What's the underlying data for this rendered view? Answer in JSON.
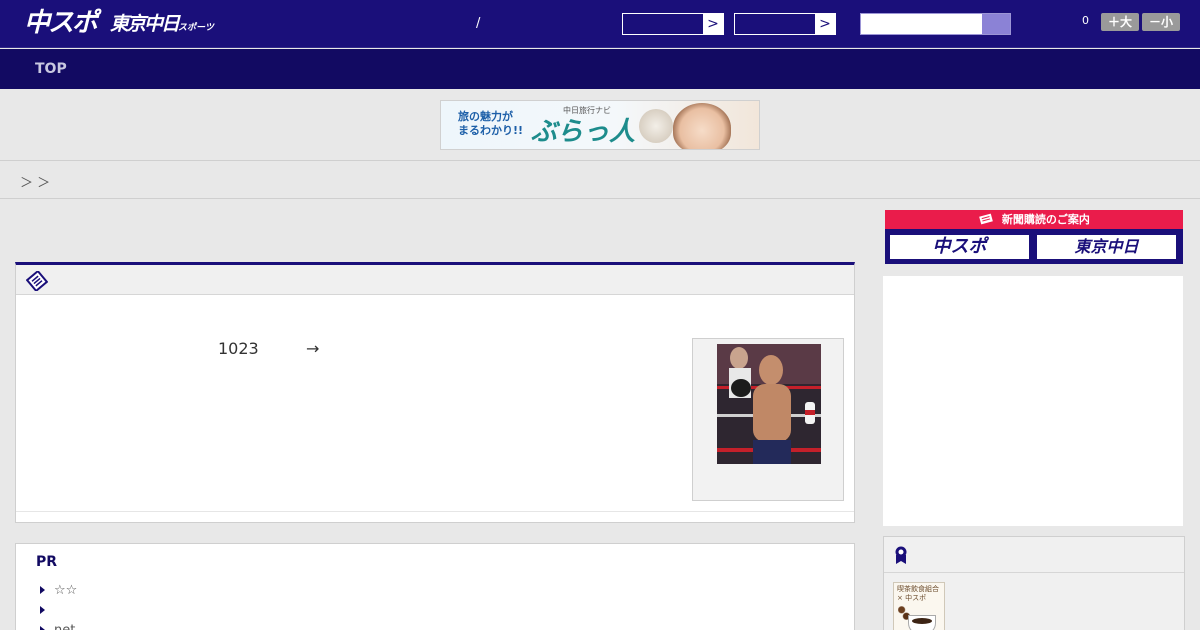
{
  "header": {
    "logo_chuspo": "中スポ",
    "logo_tokyo": "東京中日",
    "logo_tokyo_sub": "スポーツ",
    "slash": "/",
    "select_arrow": ">",
    "count": "0",
    "font_larger": "＋大",
    "font_smaller": "－小"
  },
  "nav": {
    "top_label": "TOP"
  },
  "banner": {
    "line1": "旅の魅力が",
    "line2": "まるわかり!!",
    "small": "中日旅行ナビ",
    "brand": "ぶらっ人"
  },
  "breadcrumb": "＞ ＞",
  "article": {
    "number": "1023",
    "arrow": "→"
  },
  "pr": {
    "title": "PR",
    "items": [
      "☆☆",
      "",
      "net"
    ]
  },
  "subscribe": {
    "header": "新聞購読のご案内",
    "btn_chuspo": "中スポ",
    "btn_tokyo": "東京中日"
  },
  "ranking": {
    "thumb_text1": "喫茶飲食組合",
    "thumb_text2": "× 中スポ"
  },
  "colors": {
    "header_bg": "#1a0f7a",
    "nav_bg": "#120a62",
    "accent_red": "#ea1c4b",
    "search_button": "#8b82d6"
  }
}
